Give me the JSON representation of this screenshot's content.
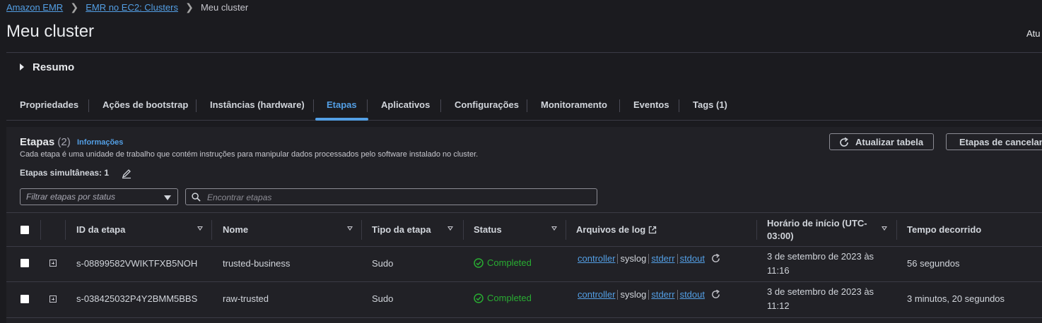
{
  "breadcrumb": {
    "items": [
      "Amazon EMR",
      "EMR no EC2: Clusters"
    ],
    "current": "Meu cluster"
  },
  "page": {
    "title": "Meu cluster",
    "top_right_text": "Atu"
  },
  "summary": {
    "label": "Resumo"
  },
  "tabs": [
    {
      "label": "Propriedades"
    },
    {
      "label": "Ações de bootstrap"
    },
    {
      "label": "Instâncias (hardware)"
    },
    {
      "label": "Etapas"
    },
    {
      "label": "Aplicativos"
    },
    {
      "label": "Configurações"
    },
    {
      "label": "Monitoramento"
    },
    {
      "label": "Eventos"
    },
    {
      "label": "Tags (1)"
    }
  ],
  "active_tab": "Etapas",
  "steps_panel": {
    "title": "Etapas",
    "count": "(2)",
    "info_link": "Informações",
    "description": "Cada etapa é uma unidade de trabalho que contém instruções para manipular dados processados pelo software instalado no cluster.",
    "concurrent_label": "Etapas simultâneas: 1",
    "refresh_button": "Atualizar tabela",
    "cancel_button": "Etapas de cancelam",
    "filter_placeholder": "Filtrar etapas por status",
    "search_placeholder": "Encontrar etapas"
  },
  "table": {
    "columns": {
      "id": "ID da etapa",
      "name": "Nome",
      "type": "Tipo da etapa",
      "status": "Status",
      "logs": "Arquivos de log",
      "start_line1": "Horário de início (UTC-",
      "start_line2": "03:00)",
      "elapsed": "Tempo decorrido"
    },
    "rows": [
      {
        "id": "s-08899582VWIKTFXB5NOH",
        "name": "trusted-business",
        "type": "Sudo",
        "status": "Completed",
        "logs": [
          "controller",
          "syslog",
          "stderr",
          "stdout"
        ],
        "start_line1": "3 de setembro de 2023 às",
        "start_line2": "11:16",
        "elapsed": "56 segundos"
      },
      {
        "id": "s-038425032P4Y2BMM5BBS",
        "name": "raw-trusted",
        "type": "Sudo",
        "status": "Completed",
        "logs": [
          "controller",
          "syslog",
          "stderr",
          "stdout"
        ],
        "start_line1": "3 de setembro de 2023 às",
        "start_line2": "11:12",
        "elapsed": "3 minutos, 20 segundos"
      }
    ]
  },
  "colors": {
    "link": "#539fe5",
    "success": "#29ad32",
    "background": "#1b1b1f"
  }
}
